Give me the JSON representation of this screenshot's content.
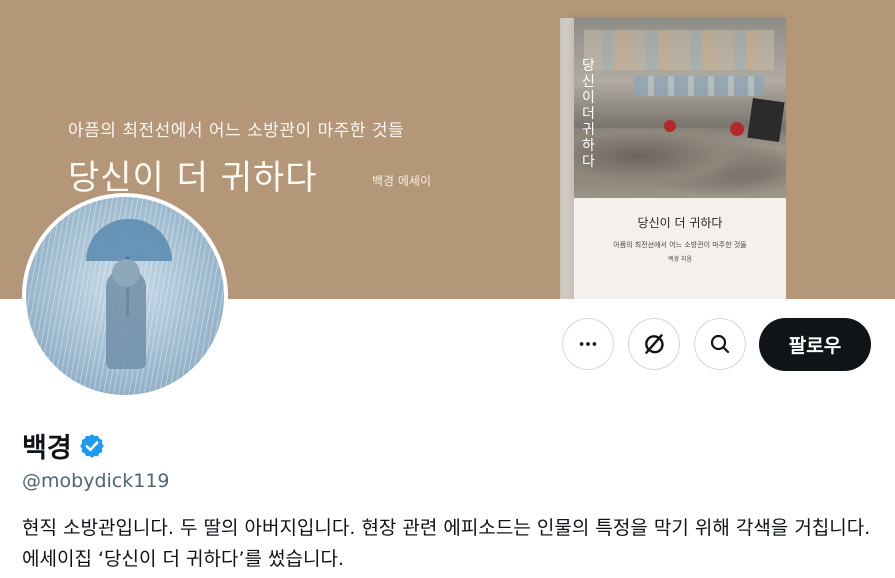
{
  "banner": {
    "subtitle": "아픔의 최전선에서 어느 소방관이 마주한 것들",
    "title": "당신이 더 귀하다",
    "author": "백경 에세이",
    "bg_color": "#b49778"
  },
  "book_cover": {
    "vertical_title": "당신이 더 귀하다",
    "title": "당신이 더 귀하다",
    "subtitle": "아픔의 최전선에서 어느 소방관이 마주한 것들",
    "author": "백경 지음"
  },
  "actions": {
    "more_icon": "more-icon",
    "grok_icon": "grok-icon",
    "search_icon": "search-icon",
    "follow_label": "팔로우"
  },
  "profile": {
    "name": "백경",
    "verified": true,
    "handle": "@mobydick119",
    "bio": "현직 소방관입니다. 두 딸의 아버지입니다. 현장 관련 에피소드는 인물의 특정을 막기 위해 각색을 거칩니다. 에세이집 ‘당신이 더 귀하다’를 썼습니다."
  },
  "colors": {
    "text_primary": "#0f1419",
    "text_secondary": "#536471",
    "verified_blue": "#1d9bf0",
    "follow_bg": "#0f1419"
  }
}
